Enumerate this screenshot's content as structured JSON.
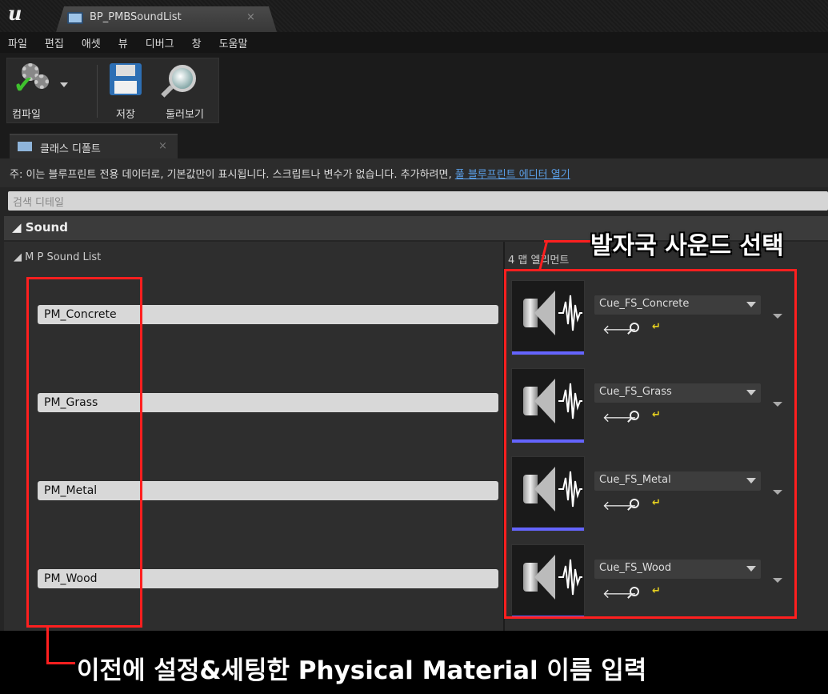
{
  "window": {
    "tab_title": "BP_PMBSoundList",
    "tab_close": "×"
  },
  "menu": [
    "파일",
    "편집",
    "애셋",
    "뷰",
    "디버그",
    "창",
    "도움말"
  ],
  "toolbar": {
    "compile_label": "컴파일",
    "save_label": "저장",
    "browse_label": "둘러보기"
  },
  "panel_tab": {
    "label": "클래스 디폴트",
    "close": "×"
  },
  "notice": {
    "text": "주: 이는 블루프린트 전용 데이터로, 기본값만이 표시됩니다. 스크립트나 변수가 없습니다. 추가하려면, ",
    "link": "풀 블루프린트 에디터 열기"
  },
  "search": {
    "placeholder": "검색 디테일"
  },
  "category": {
    "title": "◢ Sound"
  },
  "property": {
    "name": "◢ M P Sound List",
    "element_count": "4 맵 엘리먼트"
  },
  "entries": [
    {
      "key": "PM_Concrete",
      "value": "Cue_FS_Concrete"
    },
    {
      "key": "PM_Grass",
      "value": "Cue_FS_Grass"
    },
    {
      "key": "PM_Metal",
      "value": "Cue_FS_Metal"
    },
    {
      "key": "PM_Wood",
      "value": "Cue_FS_Wood"
    }
  ],
  "annotations": {
    "top": "발자국 사운드 선택",
    "bottom": "이전에 설정&세팅한 Physical Material 이름 입력"
  },
  "colors": {
    "annotation_red": "#ff1f1f",
    "link_blue": "#5a9ee6",
    "thumb_bar": "#6464ff"
  }
}
